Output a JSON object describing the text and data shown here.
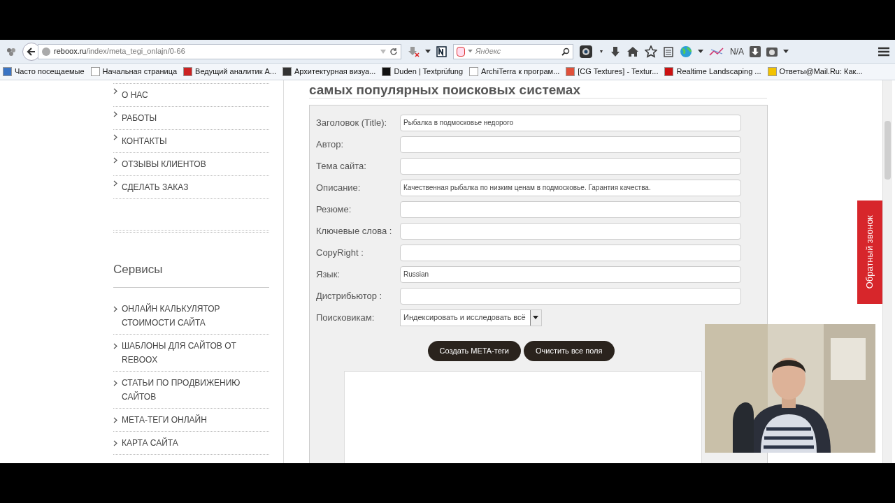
{
  "browser": {
    "url_host": "reboox.ru",
    "url_path": "/index/meta_tegi_onlajn/0-66",
    "search_placeholder": "Яндекс",
    "toolbar_text": "N/A"
  },
  "bookmarks": [
    "Часто посещаемые",
    "Начальная страница",
    "Ведущий аналитик А...",
    "Архитектурная визуа...",
    "Duden | Textprüfung",
    "ArchiTerra к програм...",
    "[CG Textures] - Textur...",
    "Realtime Landscaping ...",
    "Ответы@Mail.Ru: Как..."
  ],
  "sidebar": {
    "menu_items": [
      "О НАС",
      "РАБОТЫ",
      "КОНТАКТЫ",
      "ОТЗЫВЫ КЛИЕНТОВ",
      "СДЕЛАТЬ ЗАКАЗ"
    ],
    "section_title": "Сервисы",
    "service_items": [
      "ОНЛАЙН КАЛЬКУЛЯТОР СТОИМОСТИ САЙТА",
      "ШАБЛОНЫ ДЛЯ САЙТОВ ОТ REBOOX",
      "СТАТЬИ ПО ПРОДВИЖЕНИЮ САЙТОВ",
      "МЕТА-ТЕГИ ОНЛАЙН",
      "КАРТА САЙТА"
    ]
  },
  "main": {
    "heading": "самых популярных поисковых системах",
    "fields": [
      {
        "label": "Заголовок (Title):",
        "value": "Рыбалка в подмосковье недорого"
      },
      {
        "label": "Автор:"
      },
      {
        "label": "Тема сайта:"
      },
      {
        "label": "Описание:",
        "value": "Качественная рыбалка по низким ценам в подмосковье. Гарантия качества."
      },
      {
        "label": "Резюме:"
      },
      {
        "label": "Ключевые слова :"
      },
      {
        "label": "CopyRight :"
      },
      {
        "label": "Язык:",
        "value": "Russian"
      },
      {
        "label": "Дистрибьютор :"
      }
    ],
    "select": {
      "label": "Поисковикам:",
      "value": "Индексировать и исследовать всё"
    },
    "buttons": [
      "Создать META-теги",
      "Очистить все поля"
    ]
  },
  "callback_tab": "Обратный звонок"
}
